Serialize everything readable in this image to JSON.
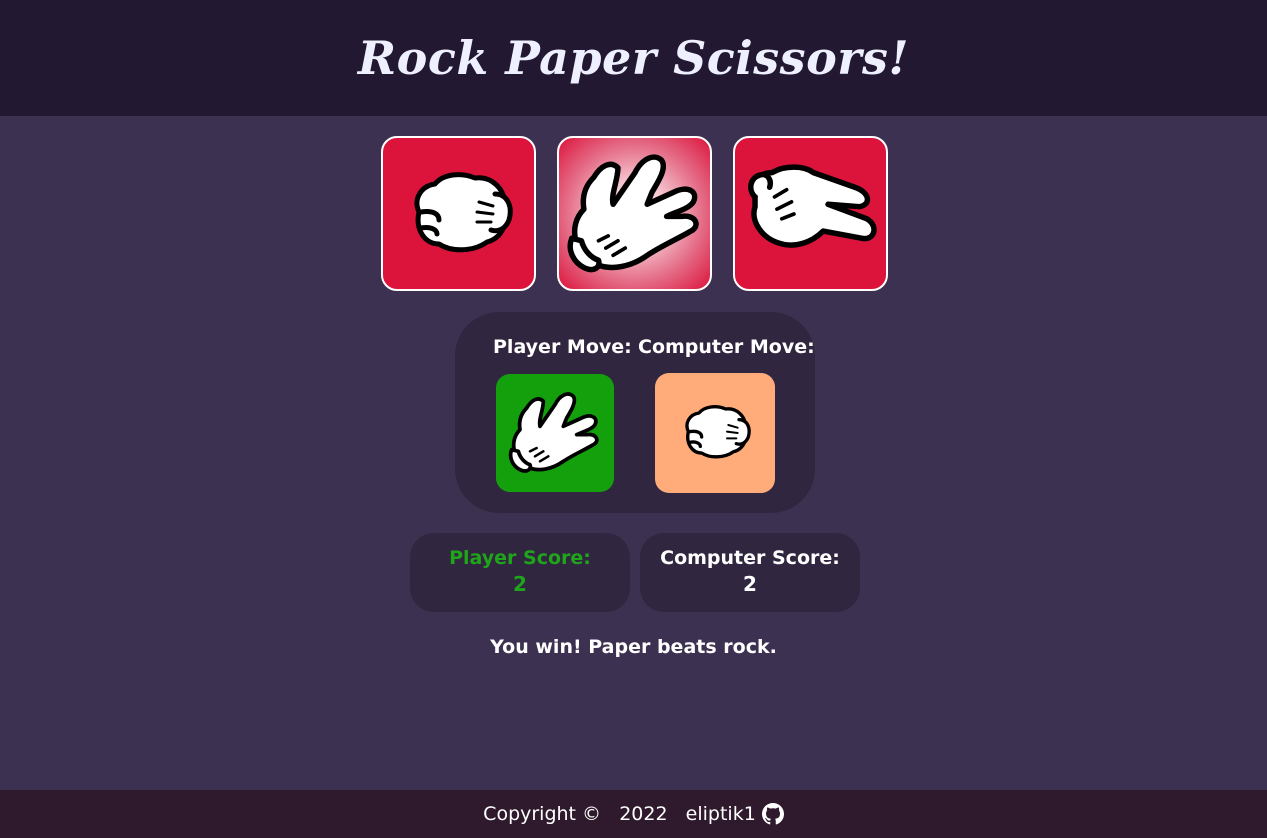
{
  "header": {
    "title": "Rock Paper Scissors!"
  },
  "choices": [
    {
      "name": "rock",
      "icon": "rock-glove-icon",
      "state": "default"
    },
    {
      "name": "paper",
      "icon": "paper-glove-icon",
      "state": "hovered"
    },
    {
      "name": "scissors",
      "icon": "scissors-glove-icon",
      "state": "default"
    }
  ],
  "moves": {
    "player_label": "Player Move:",
    "computer_label": "Computer Move:",
    "player_move_icon": "paper-glove-icon",
    "computer_move_icon": "rock-glove-icon"
  },
  "scores": {
    "player_label": "Player Score:",
    "player_value": "2",
    "computer_label": "Computer Score:",
    "computer_value": "2"
  },
  "result": {
    "message": "You win! Paper beats rock."
  },
  "footer": {
    "copyright": "Copyright ©",
    "year": "2022",
    "author": "eliptik1",
    "icon": "github-icon"
  },
  "colors": {
    "background": "#3d3151",
    "header_bg": "#221832",
    "panel_bg": "#30263f",
    "choice_bg": "#dc143c",
    "player_move_bg": "#14a00d",
    "computer_move_bg": "#ffab7a",
    "player_score_color": "#1ea51a",
    "footer_bg": "#2e1a2c"
  }
}
